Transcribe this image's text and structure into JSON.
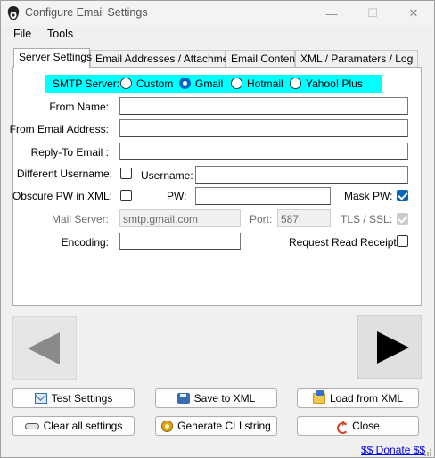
{
  "window": {
    "title": "Configure Email Settings",
    "min_symbol": "—",
    "max_symbol": "☐",
    "close_symbol": "✕"
  },
  "menu": {
    "file": "File",
    "tools": "Tools"
  },
  "tabs": [
    {
      "label": "Server Settings",
      "active": true
    },
    {
      "label": "Email Addresses / Attachment",
      "active": false
    },
    {
      "label": "Email Content",
      "active": false
    },
    {
      "label": "XML / Paramaters / Log",
      "active": false
    }
  ],
  "smtp": {
    "label": "SMTP Server:",
    "options": [
      "Custom",
      "Gmail",
      "Hotmail",
      "Yahoo! Plus"
    ],
    "selected": "Gmail",
    "highlight_color": "#00ffff"
  },
  "form": {
    "from_name_label": "From Name:",
    "from_name_value": "",
    "from_email_label": "From Email Address:",
    "from_email_value": "",
    "reply_to_label": "Reply-To Email :",
    "reply_to_value": "",
    "different_username_label": "Different Username:",
    "different_username_checked": false,
    "username_label": "Username:",
    "username_value": "",
    "obscure_pw_label": "Obscure PW in XML:",
    "obscure_pw_checked": false,
    "pw_label": "PW:",
    "pw_value": "",
    "mask_pw_label": "Mask PW:",
    "mask_pw_checked": true,
    "mail_server_label": "Mail Server:",
    "mail_server_value": "smtp.gmail.com",
    "port_label": "Port:",
    "port_value": "587",
    "tls_label": "TLS / SSL:",
    "tls_checked": true,
    "encoding_label": "Encoding:",
    "encoding_value": "",
    "read_receipt_label": "Request Read Receipt:",
    "read_receipt_checked": false
  },
  "buttons": {
    "test_settings": "Test Settings",
    "save_xml": "Save to XML",
    "load_xml": "Load from XML",
    "clear_all": "Clear all settings",
    "generate_cli": "Generate CLI string",
    "close": "Close"
  },
  "donate_link": "$$ Donate $$",
  "colors": {
    "accent": "#0067c0",
    "link": "#0000ee"
  }
}
